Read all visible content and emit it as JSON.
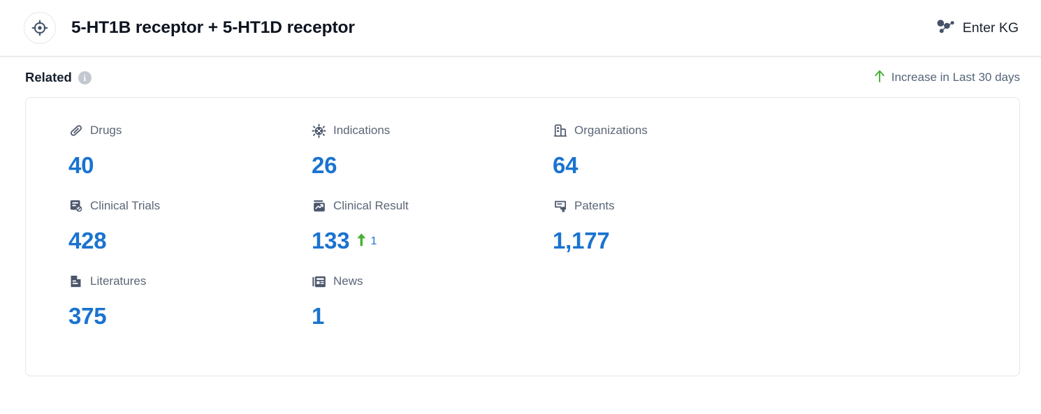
{
  "header": {
    "entity_icon": "target-crosshair-icon",
    "title": "5-HT1B receptor + 5-HT1D receptor",
    "kg_link_label": "Enter KG",
    "kg_icon": "knowledge-graph-icon"
  },
  "section": {
    "title": "Related",
    "info_icon": "info-icon",
    "legend": {
      "icon": "arrow-up-icon",
      "text": "Increase in Last 30 days",
      "color": "#45b033"
    }
  },
  "theme": {
    "value_blue": "#1a73cf",
    "label_gray": "#5a6677",
    "icon_slate": "#4b566b",
    "increase_green": "#45b033",
    "card_border": "#e4e6ea"
  },
  "stats": [
    {
      "id": "drugs",
      "icon": "pill-icon",
      "label": "Drugs",
      "value": "40",
      "delta": null
    },
    {
      "id": "indications",
      "icon": "virus-icon",
      "label": "Indications",
      "value": "26",
      "delta": null
    },
    {
      "id": "organizations",
      "icon": "building-icon",
      "label": "Organizations",
      "value": "64",
      "delta": null
    },
    {
      "id": "clinical-trials",
      "icon": "clinical-trial-document-icon",
      "label": "Clinical Trials",
      "value": "428",
      "delta": null
    },
    {
      "id": "clinical-result",
      "icon": "clinical-result-chart-icon",
      "label": "Clinical Result",
      "value": "133",
      "delta": "1"
    },
    {
      "id": "patents",
      "icon": "patent-certificate-icon",
      "label": "Patents",
      "value": "1,177",
      "delta": null
    },
    {
      "id": "literatures",
      "icon": "literature-document-icon",
      "label": "Literatures",
      "value": "375",
      "delta": null
    },
    {
      "id": "news",
      "icon": "newspaper-icon",
      "label": "News",
      "value": "1",
      "delta": null
    }
  ]
}
